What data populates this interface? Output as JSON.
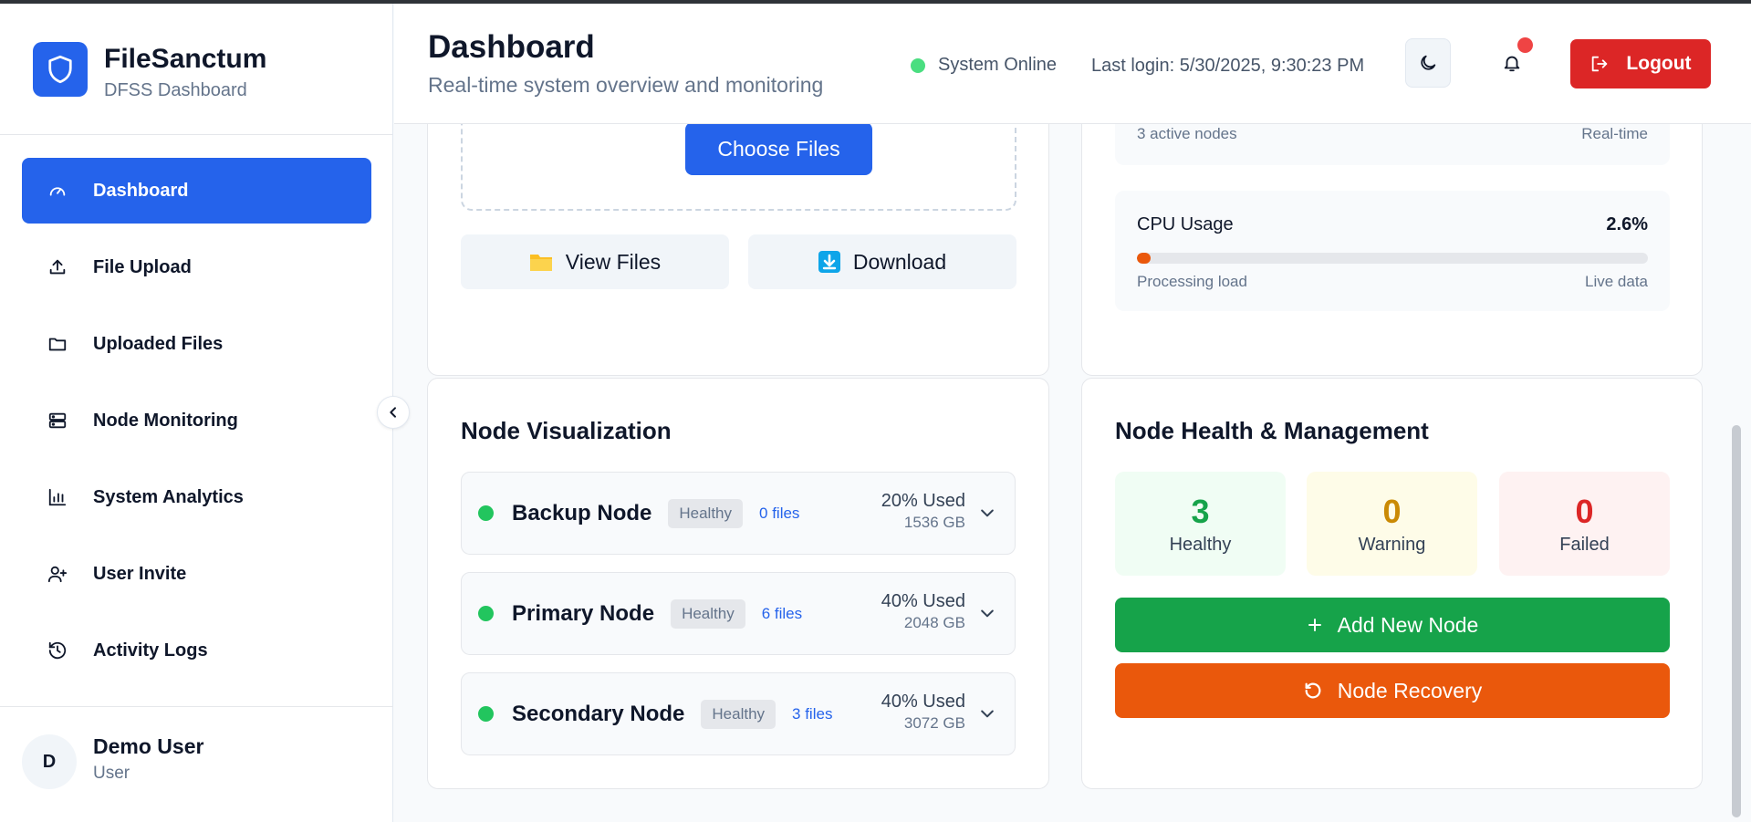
{
  "brand": {
    "name": "FileSanctum",
    "subtitle": "DFSS Dashboard"
  },
  "sidebar": {
    "items": [
      {
        "label": "Dashboard",
        "icon": "gauge-icon",
        "active": true
      },
      {
        "label": "File Upload",
        "icon": "upload-icon"
      },
      {
        "label": "Uploaded Files",
        "icon": "folder-icon"
      },
      {
        "label": "Node Monitoring",
        "icon": "server-icon"
      },
      {
        "label": "System Analytics",
        "icon": "bar-chart-icon"
      },
      {
        "label": "User Invite",
        "icon": "user-plus-icon"
      },
      {
        "label": "Activity Logs",
        "icon": "history-icon"
      }
    ]
  },
  "user": {
    "initial": "D",
    "name": "Demo User",
    "role": "User"
  },
  "header": {
    "title": "Dashboard",
    "subtitle": "Real-time system overview and monitoring",
    "status": "System Online",
    "last_login": "Last login: 5/30/2025, 9:30:23 PM",
    "logout_label": "Logout"
  },
  "upload": {
    "choose_label": "Choose Files",
    "view_label": "View Files",
    "download_label": "Download"
  },
  "metrics": {
    "nodes_foot_left": "3 active nodes",
    "nodes_foot_right": "Real-time",
    "cpu_label": "CPU Usage",
    "cpu_value": "2.6%",
    "cpu_fraction": 0.026,
    "cpu_foot_left": "Processing load",
    "cpu_foot_right": "Live data"
  },
  "visualization": {
    "title": "Node Visualization",
    "nodes": [
      {
        "name": "Backup Node",
        "status": "Healthy",
        "files": "0 files",
        "used": "20% Used",
        "capacity": "1536 GB"
      },
      {
        "name": "Primary Node",
        "status": "Healthy",
        "files": "6 files",
        "used": "40% Used",
        "capacity": "2048 GB"
      },
      {
        "name": "Secondary Node",
        "status": "Healthy",
        "files": "3 files",
        "used": "40% Used",
        "capacity": "3072 GB"
      }
    ]
  },
  "health": {
    "title": "Node Health & Management",
    "healthy_count": "3",
    "healthy_label": "Healthy",
    "warning_count": "0",
    "warning_label": "Warning",
    "failed_count": "0",
    "failed_label": "Failed",
    "add_label": "Add New Node",
    "recovery_label": "Node Recovery"
  },
  "colors": {
    "accent": "#2563eb",
    "danger": "#dc2626",
    "success": "#16a34a",
    "warning": "#ca8a04",
    "orange": "#ea580c"
  }
}
